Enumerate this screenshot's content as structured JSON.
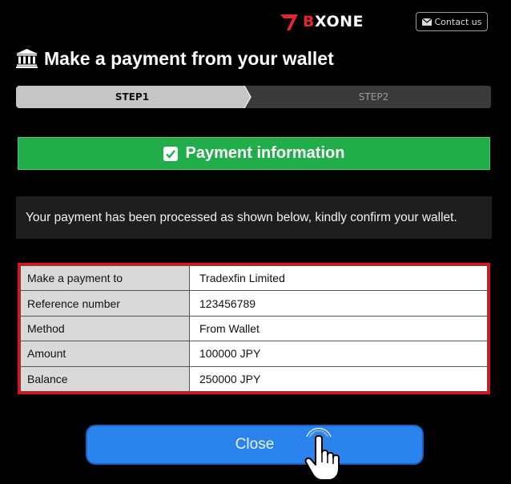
{
  "header": {
    "logo_prefix": "B",
    "logo_text": "XONE",
    "contact_label": "Contact us",
    "icons": {
      "logo": "bxone-logo",
      "contact": "mail-icon"
    }
  },
  "title": {
    "text": "Make a payment from your wallet",
    "icon": "bank-icon"
  },
  "stepper": {
    "steps": [
      {
        "label": "STEP1",
        "active": true
      },
      {
        "label": "STEP2",
        "active": false
      }
    ]
  },
  "info_bar": {
    "title": "Payment information",
    "icon": "checkbox-checked-icon",
    "color": "#20ad4a"
  },
  "message": {
    "text": "Your payment has been processed as shown below, kindly confirm your wallet."
  },
  "details": {
    "rows": [
      {
        "label": "Make a payment to",
        "value": "Tradexfin Limited"
      },
      {
        "label": "Reference number",
        "value": "123456789"
      },
      {
        "label": "Method",
        "value": "From Wallet"
      },
      {
        "label": "Amount",
        "value": "100000 JPY"
      },
      {
        "label": "Balance",
        "value": "250000 JPY"
      }
    ],
    "highlight_color": "#e3101a"
  },
  "close_button": {
    "label": "Close",
    "color": "#2b83ee",
    "cursor_icon": "pointer-hand-icon"
  }
}
